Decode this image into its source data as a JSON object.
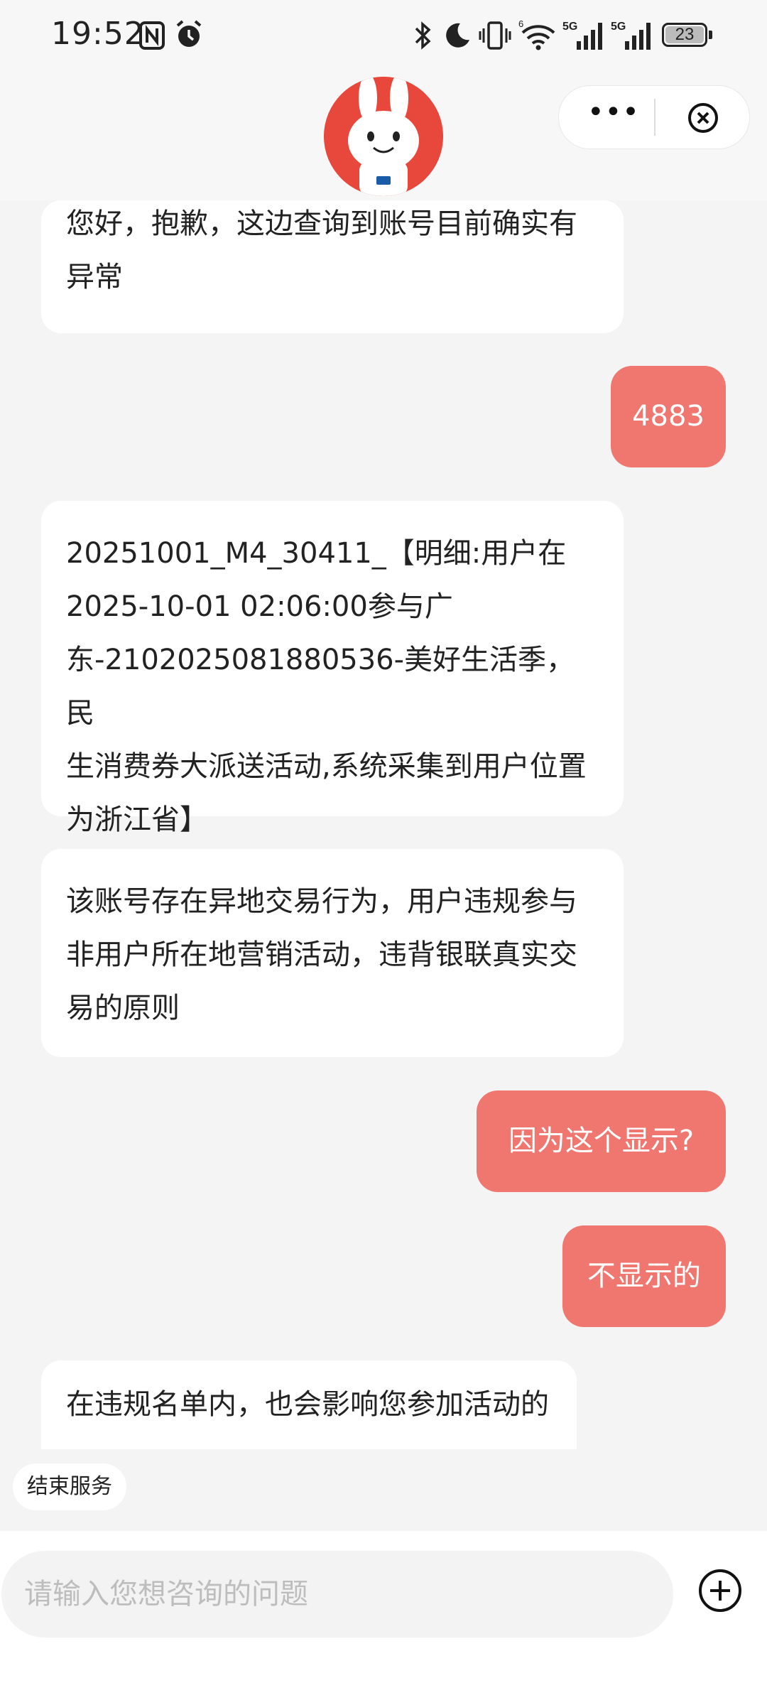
{
  "status_bar": {
    "time": "19:52",
    "battery": "23",
    "network_1": "5G",
    "network_2": "5G",
    "icons": [
      "nfc-icon",
      "alarm-icon",
      "bluetooth-icon",
      "moon-icon",
      "vibrate-icon",
      "wifi-icon",
      "signal-icon",
      "battery-icon"
    ]
  },
  "header": {
    "avatar": "mascot-avatar",
    "more_icon": "more-icon",
    "close_icon": "close-circle-icon"
  },
  "messages": [
    {
      "side": "left",
      "text": [
        "您好，抱歉，这边查询到账号目前确实有",
        "异常"
      ]
    },
    {
      "side": "right",
      "text": "4883"
    },
    {
      "side": "left",
      "text": [
        "20251001_M4_30411_【明细:用户在",
        "2025-10-01 02:06:00参与广",
        "东-2102025081880536-美好生活季，民",
        "生消费券大派送活动,系统采集到用户位置",
        "为浙江省】"
      ]
    },
    {
      "side": "left",
      "text": [
        "该账号存在异地交易行为，用户违规参与",
        "非用户所在地营销活动，违背银联真实交",
        "易的原则"
      ]
    },
    {
      "side": "right",
      "text": "因为这个显示?"
    },
    {
      "side": "right",
      "text": "不显示的"
    },
    {
      "side": "left",
      "text": [
        "在违规名单内，也会影响您参加活动的"
      ]
    }
  ],
  "end_service_label": "结束服务",
  "input": {
    "placeholder": "请输入您想咨询的问题"
  },
  "colors": {
    "user_bubble": "#f07770",
    "agent_bubble": "#ffffff",
    "background": "#f4f4f4",
    "brand_red": "#e8473c"
  }
}
